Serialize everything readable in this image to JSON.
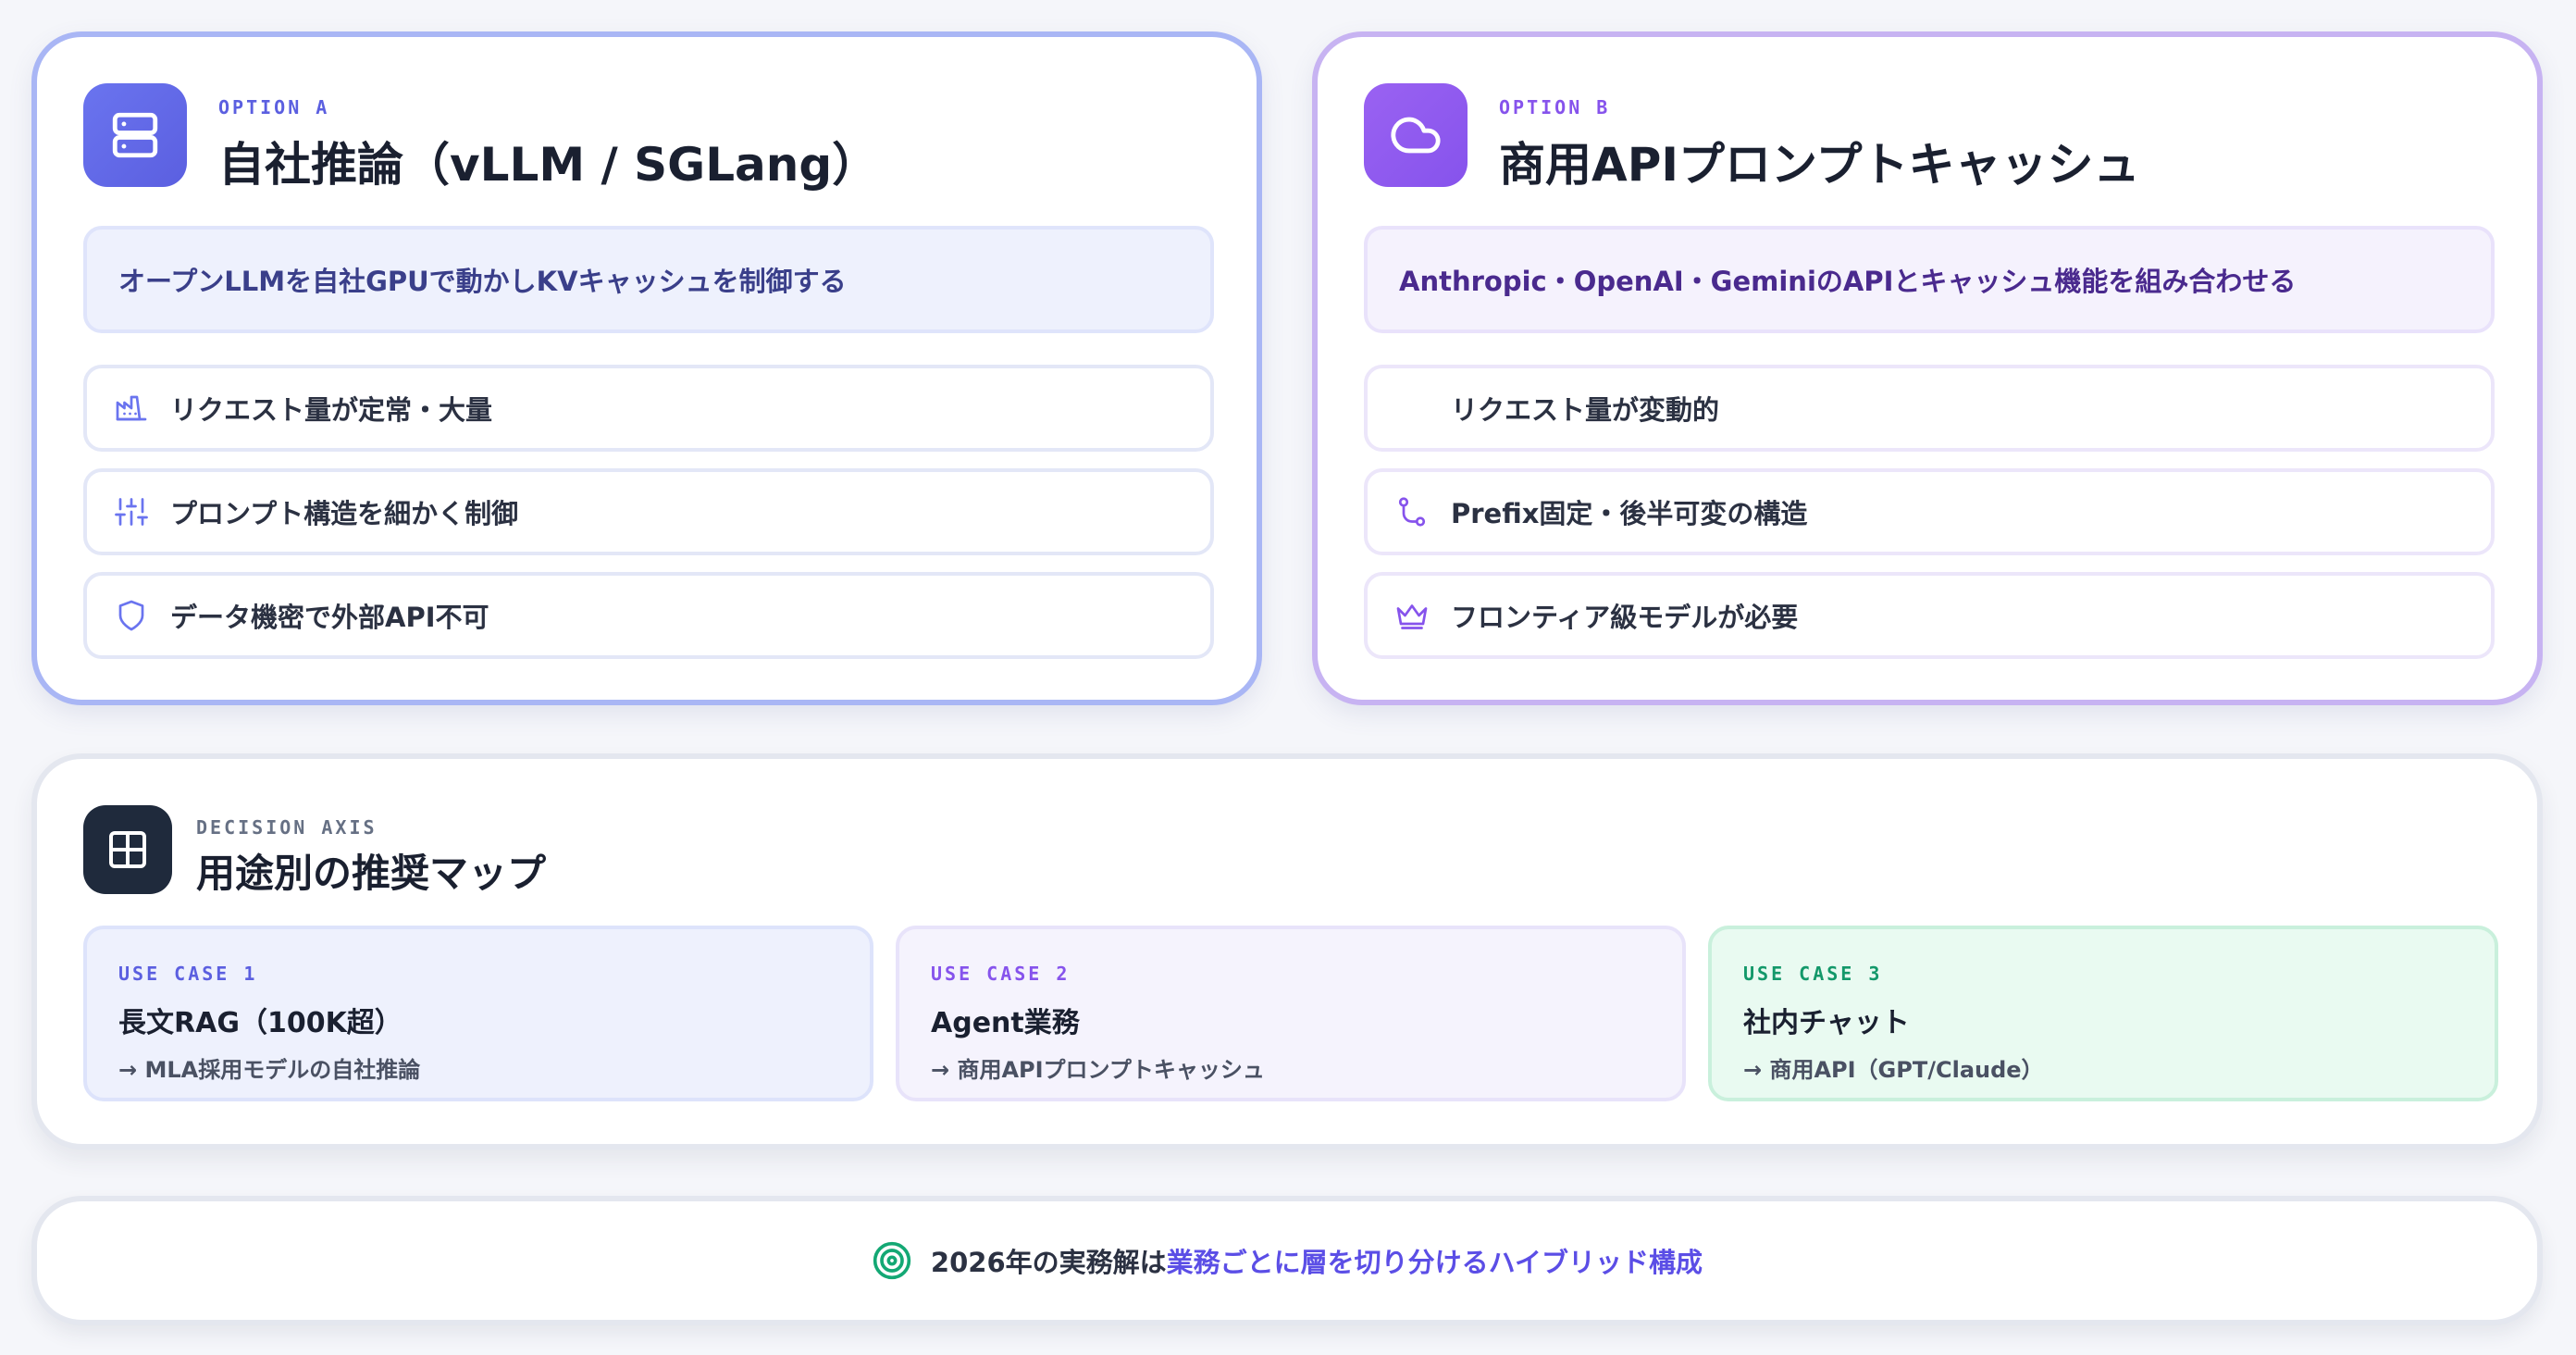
{
  "option_a": {
    "kicker": "OPTION A",
    "title": "自社推論（vLLM / SGLang）",
    "description": "オープンLLMを自社GPUで動かしKVキャッシュを制御する",
    "icon": "server-icon",
    "accent": "#5b5fe0",
    "features": [
      {
        "icon": "factory-icon",
        "label": "リクエスト量が定常・大量"
      },
      {
        "icon": "sliders-icon",
        "label": "プロンプト構造を細かく制御"
      },
      {
        "icon": "shield-icon",
        "label": "データ機密で外部API不可"
      }
    ]
  },
  "option_b": {
    "kicker": "OPTION B",
    "title": "商用APIプロンプトキャッシュ",
    "description": "Anthropic・OpenAI・GeminiのAPIとキャッシュ機能を組み合わせる",
    "icon": "cloud-icon",
    "accent": "#8653ec",
    "features": [
      {
        "icon": "blank-icon",
        "label": "リクエスト量が変動的"
      },
      {
        "icon": "git-branch-icon",
        "label": "Prefix固定・後半可変の構造"
      },
      {
        "icon": "crown-icon",
        "label": "フロンティア級モデルが必要"
      }
    ]
  },
  "decision_axis": {
    "kicker": "DECISION AXIS",
    "title": "用途別の推奨マップ",
    "icon": "layout-grid-icon",
    "use_cases": [
      {
        "kicker": "USE CASE 1",
        "title": "長文RAG（100K超）",
        "recommendation": "→ MLA採用モデルの自社推論",
        "accent": "#5b5fe0"
      },
      {
        "kicker": "USE CASE 2",
        "title": "Agent業務",
        "recommendation": "→ 商用APIプロンプトキャッシュ",
        "accent": "#8653ec"
      },
      {
        "kicker": "USE CASE 3",
        "title": "社内チャット",
        "recommendation": "→ 商用API（GPT/Claude）",
        "accent": "#13986a"
      }
    ]
  },
  "conclusion": {
    "icon": "target-icon",
    "prefix": "2026年の実務解は",
    "emphasis": "業務ごとに層を切り分けるハイブリッド構成",
    "accent": "#5b4ee6"
  }
}
